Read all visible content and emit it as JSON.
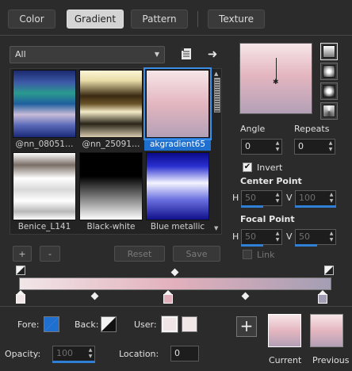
{
  "tabs": [
    {
      "label": "Color"
    },
    {
      "label": "Gradient"
    },
    {
      "label": "Pattern"
    },
    {
      "label": "Texture"
    }
  ],
  "category": {
    "selected": "All"
  },
  "gallery": [
    {
      "name": "@nn_08051…"
    },
    {
      "name": "@nn_25091…"
    },
    {
      "name": "akgradient65"
    },
    {
      "name": "Benice_L141"
    },
    {
      "name": "Black-white"
    },
    {
      "name": "Blue metallic"
    }
  ],
  "buttons": {
    "add": "+",
    "remove": "-",
    "reset": "Reset",
    "save": "Save"
  },
  "angle": {
    "label": "Angle",
    "value": "0"
  },
  "repeats": {
    "label": "Repeats",
    "value": "0"
  },
  "invert": {
    "label": "Invert",
    "checked": true
  },
  "center_point": {
    "title": "Center Point",
    "h_label": "H",
    "h_value": "50",
    "v_label": "V",
    "v_value": "100"
  },
  "focal_point": {
    "title": "Focal Point",
    "h_label": "H",
    "h_value": "50",
    "v_label": "V",
    "v_value": "50"
  },
  "link": {
    "label": "Link",
    "checked": false
  },
  "bottom": {
    "fore_label": "Fore:",
    "back_label": "Back:",
    "user_label": "User:",
    "opacity_label": "Opacity:",
    "opacity_value": "100",
    "location_label": "Location:",
    "location_value": "0",
    "current_label": "Current",
    "previous_label": "Previous",
    "add_symbol": "+"
  },
  "colors": {
    "accent": "#3a8ee6",
    "gradient_start": "#f1e6e8",
    "gradient_mid": "#e2b0bc",
    "gradient_end": "#a49eb4"
  }
}
